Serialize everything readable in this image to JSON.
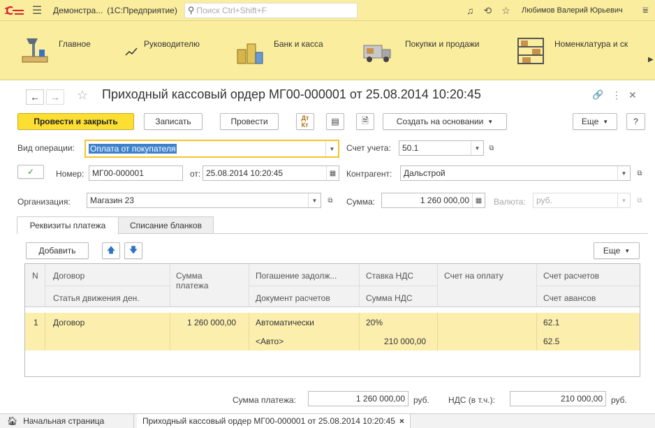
{
  "app": {
    "title": "Демонстра...",
    "subtitle": "(1С:Предприятие)",
    "search_placeholder": "Поиск Ctrl+Shift+F",
    "user": "Любимов Валерий Юрьевич"
  },
  "sections": [
    {
      "label": "Главное"
    },
    {
      "label": "Руководителю"
    },
    {
      "label": "Банк и касса"
    },
    {
      "label": "Покупки и продажи"
    },
    {
      "label": "Номенклатура и ск"
    }
  ],
  "form": {
    "title": "Приходный кассовый ордер МГ00-000001 от 25.08.2014 10:20:45"
  },
  "toolbar": {
    "post_close": "Провести и закрыть",
    "save": "Записать",
    "post": "Провести",
    "create_based": "Создать на основании",
    "more": "Еще",
    "help": "?"
  },
  "fields": {
    "op_type_label": "Вид операции:",
    "op_type_value": "Оплата от покупателя",
    "account_label": "Счет учета:",
    "account_value": "50.1",
    "number_label": "Номер:",
    "number_value": "МГ00-000001",
    "date_label": "от:",
    "date_value": "25.08.2014 10:20:45",
    "counterparty_label": "Контрагент:",
    "counterparty_value": "Дальстрой",
    "org_label": "Организация:",
    "org_value": "Магазин 23",
    "sum_label": "Сумма:",
    "sum_value": "1 260 000,00",
    "currency_label": "Валюта:",
    "currency_value": "руб."
  },
  "tabs": [
    {
      "label": "Реквизиты платежа"
    },
    {
      "label": "Списание бланков"
    }
  ],
  "table_toolbar": {
    "add": "Добавить",
    "more": "Еще"
  },
  "table": {
    "headers": {
      "n": "N",
      "contract": "Договор",
      "cashflow": "Статья движения ден.",
      "amount_1": "Сумма",
      "amount_2": "платежа",
      "repay": "Погашение задолж...",
      "settle_doc": "Документ расчетов",
      "vat_rate": "Ставка НДС",
      "vat_sum": "Сумма НДС",
      "invoice": "Счет на оплату",
      "settle_acc": "Счет расчетов",
      "advance_acc": "Счет авансов"
    },
    "row": {
      "n": "1",
      "contract": "Договор",
      "amount": "1 260 000,00",
      "repay": "Автоматически",
      "settle_doc": "<Авто>",
      "vat_rate": "20%",
      "vat_sum": "210 000,00",
      "settle_acc": "62.1",
      "advance_acc": "62.5"
    }
  },
  "totals": {
    "payment_label": "Сумма платежа:",
    "payment_value": "1 260 000,00",
    "payment_currency": "руб.",
    "vat_label": "НДС (в т.ч.):",
    "vat_value": "210 000,00",
    "vat_currency": "руб."
  },
  "statusbar": {
    "home": "Начальная страница",
    "doc_tab": "Приходный кассовый ордер МГ00-000001 от 25.08.2014 10:20:45"
  }
}
